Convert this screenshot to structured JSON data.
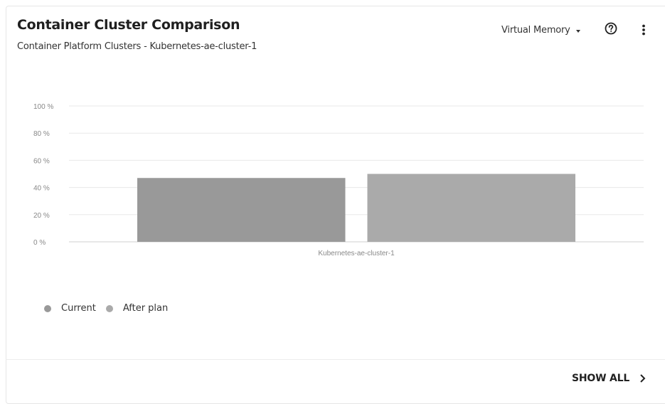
{
  "card": {
    "title": "Container Cluster Comparison",
    "subtitle": "Container Platform Clusters - Kubernetes-ae-cluster-1",
    "metric_selector": "Virtual Memory",
    "help_icon": "help-circle-icon",
    "menu_icon": "kebab-menu-icon",
    "show_all_label": "SHOW ALL"
  },
  "chart_data": {
    "type": "bar",
    "title": "",
    "xlabel": "",
    "ylabel": "",
    "categories": [
      "Kubernetes-ae-cluster-1"
    ],
    "series": [
      {
        "name": "Current",
        "values": [
          47
        ],
        "color": "#999999"
      },
      {
        "name": "After plan",
        "values": [
          50
        ],
        "color": "#aaaaaa"
      }
    ],
    "ylim": [
      0,
      100
    ],
    "yticks": [
      "0 %",
      "20 %",
      "40 %",
      "60 %",
      "80 %",
      "100 %"
    ],
    "grid": true,
    "legend_position": "bottom-left"
  }
}
